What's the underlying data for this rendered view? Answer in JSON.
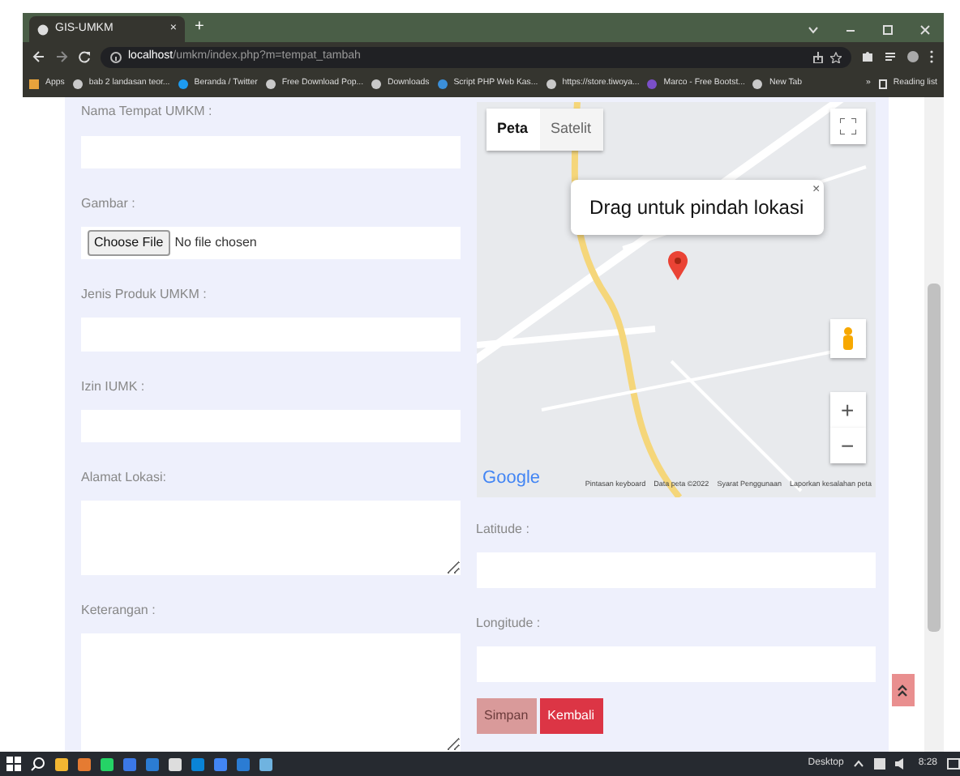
{
  "browser": {
    "tab_title": "GIS-UMKM",
    "tab_close": "×",
    "new_tab": "+",
    "address": "**localhost**/umkm/index.php?m=tempat_tambah",
    "bookmarks": [
      {
        "label": "Apps",
        "color": "#e8a33c"
      },
      {
        "label": "bab 2 landasan teor...",
        "color": "#c9c9c9"
      },
      {
        "label": "Beranda / Twitter",
        "color": "#1d9bf0"
      },
      {
        "label": "Free Download Pop...",
        "color": "#c9c9c9"
      },
      {
        "label": "Downloads",
        "color": "#c9c9c9"
      },
      {
        "label": "Script PHP Web Kas...",
        "color": "#3b8fd9"
      },
      {
        "label": "https://store.tiwoya...",
        "color": "#c9c9c9"
      },
      {
        "label": "Marco - Free Bootst...",
        "color": "#7b4fc9"
      },
      {
        "label": "New Tab",
        "color": "#c9c9c9"
      }
    ],
    "more": "»",
    "reading_list": "Reading list"
  },
  "left_fields": [
    {
      "kind": "text",
      "label": "Nama Tempat UMKM :"
    },
    {
      "kind": "file",
      "label": "Gambar :",
      "button": "Choose File",
      "status": "No file chosen"
    },
    {
      "kind": "text",
      "label": "Jenis Produk UMKM :"
    },
    {
      "kind": "text",
      "label": "Izin IUMK :"
    },
    {
      "kind": "textarea",
      "label": "Alamat Lokasi:"
    },
    {
      "kind": "textarea",
      "label": "Keterangan :"
    }
  ],
  "map": {
    "types": [
      {
        "label": "Peta",
        "selected": true
      },
      {
        "label": "Satelit",
        "selected": false
      }
    ],
    "info_window": "Drag untuk pindah lokasi",
    "info_close": "×",
    "logo": "Google",
    "zoom_in": "+",
    "zoom_out": "−",
    "footer": [
      "Pintasan keyboard",
      "Data peta ©2022",
      "Syarat Penggunaan",
      "Laporkan kesalahan peta"
    ]
  },
  "right_fields": [
    {
      "label": "Latitude :"
    },
    {
      "label": "Longitude :"
    }
  ],
  "buttons": [
    {
      "label": "Simpan",
      "disabled": true
    },
    {
      "label": "Kembali",
      "disabled": false
    }
  ],
  "taskbar": {
    "desktop": "Desktop",
    "time": "8:28"
  }
}
